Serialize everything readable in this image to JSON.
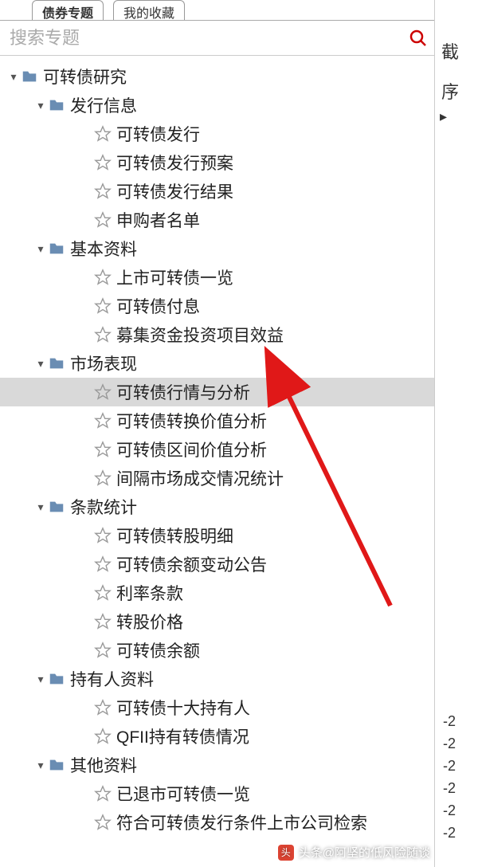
{
  "tabs": {
    "active": "债券专题",
    "inactive": "我的收藏"
  },
  "search": {
    "placeholder": "搜索专题"
  },
  "tree": [
    {
      "label": "可转债研究",
      "type": "folder",
      "indent": 0,
      "expanded": true
    },
    {
      "label": "发行信息",
      "type": "folder",
      "indent": 1,
      "expanded": true
    },
    {
      "label": "可转债发行",
      "type": "leaf",
      "indent": 2
    },
    {
      "label": "可转债发行预案",
      "type": "leaf",
      "indent": 2
    },
    {
      "label": "可转债发行结果",
      "type": "leaf",
      "indent": 2
    },
    {
      "label": "申购者名单",
      "type": "leaf",
      "indent": 2
    },
    {
      "label": "基本资料",
      "type": "folder",
      "indent": 1,
      "expanded": true
    },
    {
      "label": "上市可转债一览",
      "type": "leaf",
      "indent": 2
    },
    {
      "label": "可转债付息",
      "type": "leaf",
      "indent": 2
    },
    {
      "label": "募集资金投资项目效益",
      "type": "leaf",
      "indent": 2
    },
    {
      "label": "市场表现",
      "type": "folder",
      "indent": 1,
      "expanded": true
    },
    {
      "label": "可转债行情与分析",
      "type": "leaf",
      "indent": 2,
      "selected": true
    },
    {
      "label": "可转债转换价值分析",
      "type": "leaf",
      "indent": 2
    },
    {
      "label": "可转债区间价值分析",
      "type": "leaf",
      "indent": 2
    },
    {
      "label": "间隔市场成交情况统计",
      "type": "leaf",
      "indent": 2
    },
    {
      "label": "条款统计",
      "type": "folder",
      "indent": 1,
      "expanded": true
    },
    {
      "label": "可转债转股明细",
      "type": "leaf",
      "indent": 2
    },
    {
      "label": "可转债余额变动公告",
      "type": "leaf",
      "indent": 2
    },
    {
      "label": "利率条款",
      "type": "leaf",
      "indent": 2
    },
    {
      "label": "转股价格",
      "type": "leaf",
      "indent": 2
    },
    {
      "label": "可转债余额",
      "type": "leaf",
      "indent": 2
    },
    {
      "label": "持有人资料",
      "type": "folder",
      "indent": 1,
      "expanded": true
    },
    {
      "label": "可转债十大持有人",
      "type": "leaf",
      "indent": 2
    },
    {
      "label": "QFII持有转债情况",
      "type": "leaf",
      "indent": 2
    },
    {
      "label": "其他资料",
      "type": "folder",
      "indent": 1,
      "expanded": true
    },
    {
      "label": "已退市可转债一览",
      "type": "leaf",
      "indent": 2
    },
    {
      "label": "符合可转债发行条件上市公司检索",
      "type": "leaf",
      "indent": 2
    }
  ],
  "right_labels": {
    "top": "截",
    "seq": "序",
    "vals": [
      "-2",
      "-2",
      "-2",
      "-2",
      "-2",
      "-2"
    ]
  },
  "watermark": "头条@阿坚的低风险随谈"
}
